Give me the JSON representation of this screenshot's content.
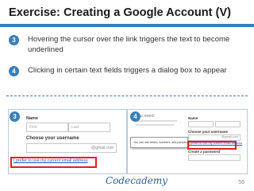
{
  "title": "Exercise: Creating a Google Account (V)",
  "steps": [
    {
      "num": "3",
      "text": "Hovering the cursor over the link triggers the text to become underlined"
    },
    {
      "num": "4",
      "text": "Clicking in certain text fields triggers a dialog box to appear"
    }
  ],
  "shot3": {
    "badge": "3",
    "name_label": "Name",
    "first_placeholder": "First",
    "last_placeholder": "Last",
    "username_label": "Choose your username",
    "domain": "@gmail.com",
    "link": "I prefer to use my current email address"
  },
  "shot4": {
    "badge": "4",
    "you_need": "you need",
    "tooltip": "You can use letters, numbers, and periods.",
    "name_label": "Name",
    "username_label": "Choose your username",
    "domain": "@gmail.com",
    "link": "I prefer to use my current email address",
    "password_label": "Create a password"
  },
  "logo": "Codecademy",
  "page_number": "56",
  "colors": {
    "accent": "#3a7fb8",
    "highlight": "#e02020",
    "link": "#1a56c4"
  }
}
